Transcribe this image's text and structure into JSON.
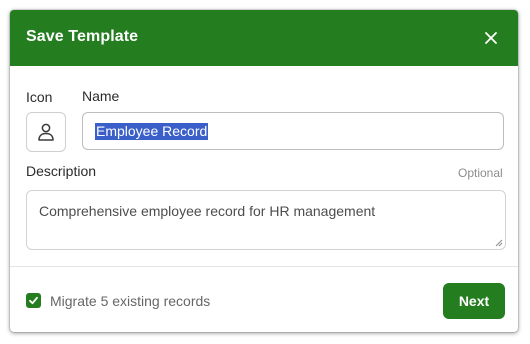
{
  "dialog": {
    "title": "Save Template",
    "close_icon": "close-icon"
  },
  "form": {
    "icon_label": "Icon",
    "icon_name": "user-icon",
    "name_label": "Name",
    "name_value": "Employee Record",
    "name_selected": true,
    "description_label": "Description",
    "description_optional": "Optional",
    "description_value": "Comprehensive employee record for HR management"
  },
  "footer": {
    "migrate_checked": true,
    "migrate_label": "Migrate 5 existing records",
    "next_label": "Next"
  },
  "colors": {
    "accent": "#247d1f",
    "selection": "#3a5fc9"
  }
}
